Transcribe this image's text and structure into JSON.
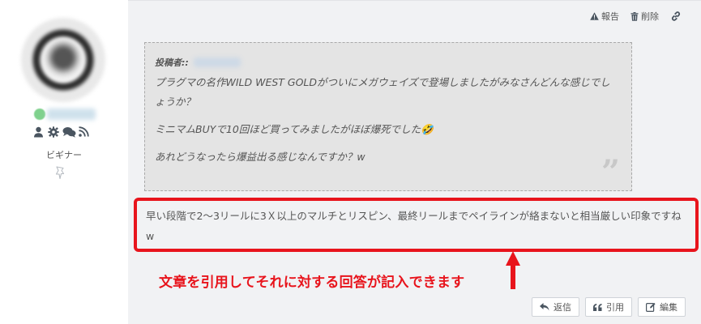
{
  "user": {
    "rank": "ビギナー",
    "icons": [
      "user-icon",
      "gear-icon",
      "comments-icon",
      "rss-icon"
    ],
    "online_color": "#7fd18d"
  },
  "actions": {
    "report": "報告",
    "delete": "削除"
  },
  "quote": {
    "author_prefix": "投稿者::",
    "paragraphs": [
      "プラグマの名作WILD WEST GOLDがついにメガウェイズで登場しましたがみなさんどんな感じでしょうか？",
      "ミニマムBUYで10回ほど買ってみましたがほぼ爆死でした🤣",
      "あれどうなったら爆益出る感じなんですか？w"
    ],
    "background": "#e4e4e4"
  },
  "answer": {
    "text": "早い段階で2〜3リールに3Ｘ以上のマルチとリスピン、最終リールまでペイラインが絡まないと相当厳しい印象ですねw",
    "highlight_color": "#e8141c"
  },
  "annotation": {
    "text": "文章を引用してそれに対する回答が記入できます"
  },
  "buttons": {
    "reply": "返信",
    "quote": "引用",
    "edit": "編集"
  }
}
